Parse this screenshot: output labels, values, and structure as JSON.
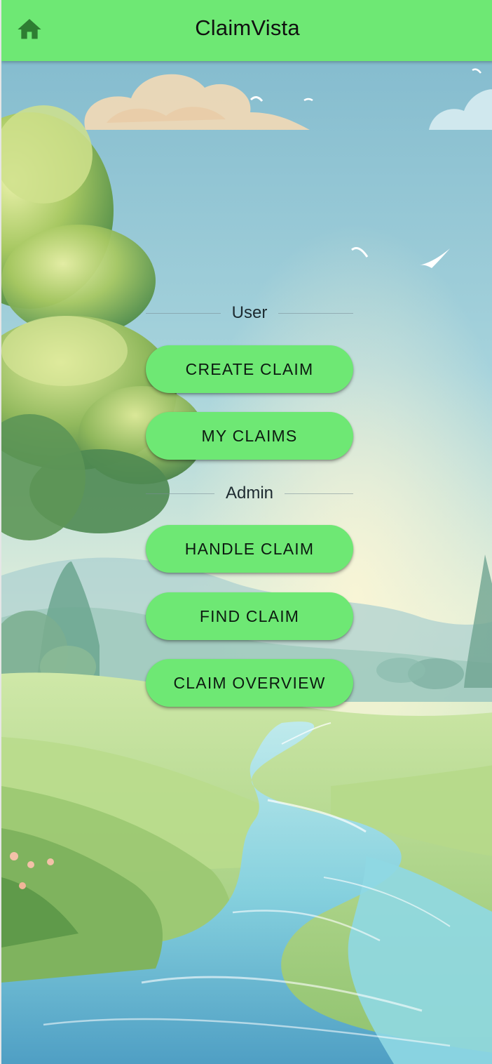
{
  "appbar": {
    "title": "ClaimVista",
    "home_icon": "home-icon",
    "color": "#6ee874"
  },
  "sections": {
    "user_label": "User",
    "admin_label": "Admin"
  },
  "buttons": {
    "create_claim": "CREATE CLAIM",
    "my_claims": "MY CLAIMS",
    "handle_claim": "HANDLE CLAIM",
    "find_claim": "FIND CLAIM",
    "claim_overview": "CLAIM OVERVIEW"
  },
  "colors": {
    "accent": "#6ee874",
    "sky": "#8ecbdc",
    "river": "#7fd4e0",
    "grass": "#a8d48a"
  }
}
